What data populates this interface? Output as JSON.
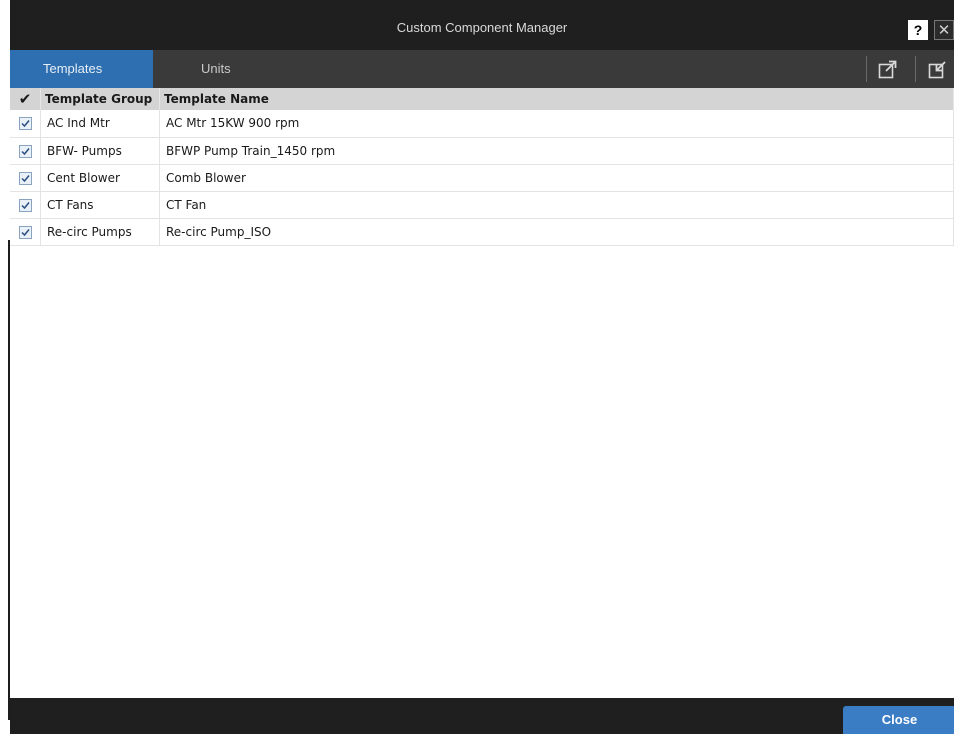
{
  "window": {
    "title": "Custom Component Manager",
    "help_label": "?",
    "close_symbol": "✕"
  },
  "tabs": [
    {
      "label": "Templates",
      "active": true
    },
    {
      "label": "Units",
      "active": false
    }
  ],
  "toolbar": {
    "icons": [
      "export-icon",
      "import-icon"
    ]
  },
  "table": {
    "check_header": "✔",
    "columns": [
      "Template Group",
      "Template Name"
    ],
    "rows": [
      {
        "checked": true,
        "group": "AC Ind Mtr",
        "name": "AC Mtr 15KW 900 rpm"
      },
      {
        "checked": true,
        "group": "BFW- Pumps",
        "name": "BFWP Pump Train_1450 rpm"
      },
      {
        "checked": true,
        "group": "Cent Blower",
        "name": "Comb Blower"
      },
      {
        "checked": true,
        "group": "CT Fans",
        "name": "CT Fan"
      },
      {
        "checked": true,
        "group": "Re-circ Pumps",
        "name": "Re-circ Pump_ISO"
      }
    ]
  },
  "footer": {
    "close_label": "Close"
  },
  "colors": {
    "titlebar": "#1f1f1f",
    "tab_active": "#2d6fb0",
    "tabbar": "#3a3a3a",
    "header_row": "#d4d4d4",
    "close_button": "#3b7dc4"
  }
}
